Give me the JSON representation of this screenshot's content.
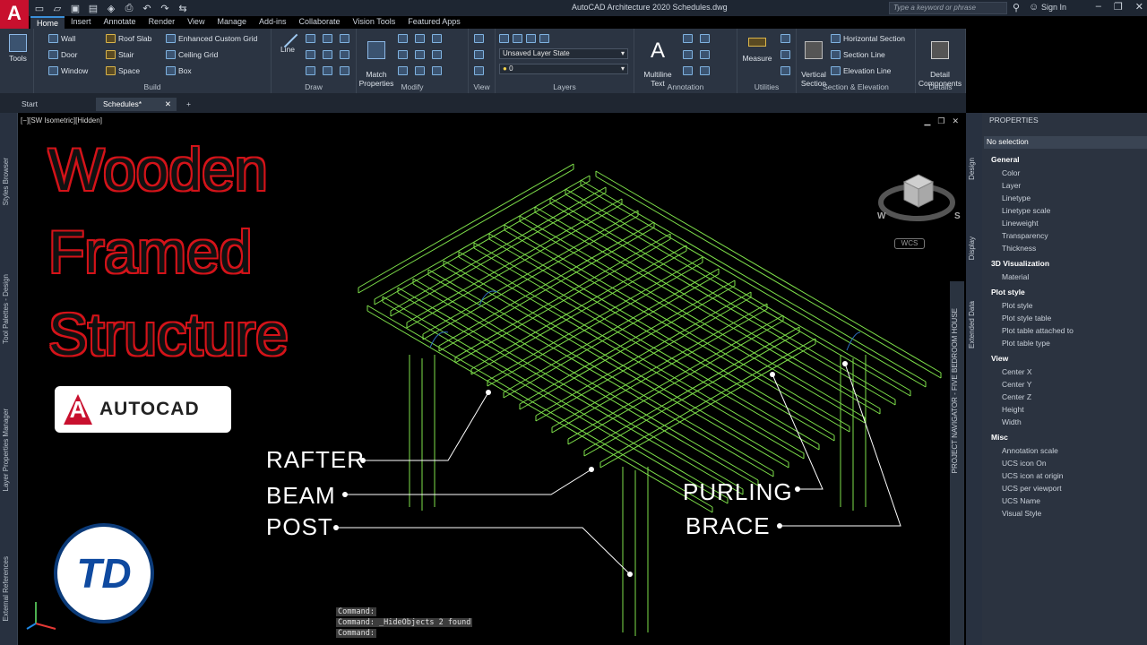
{
  "titlebar": {
    "logo": "A",
    "title": "AutoCAD Architecture 2020    Schedules.dwg",
    "search_placeholder": "Type a keyword or phrase",
    "signin": "Sign In"
  },
  "ribbon_tabs": [
    "Home",
    "Insert",
    "Annotate",
    "Render",
    "View",
    "Manage",
    "Add-ins",
    "Collaborate",
    "Vision Tools",
    "Featured Apps"
  ],
  "ribbon": {
    "tools": "Tools",
    "build": {
      "title": "Build",
      "items": [
        "Wall",
        "Door",
        "Window",
        "Roof Slab",
        "Stair",
        "Space",
        "Enhanced Custom Grid",
        "Ceiling Grid",
        "Box"
      ]
    },
    "draw": {
      "title": "Draw",
      "line": "Line"
    },
    "modify": {
      "title": "Modify",
      "match": "Match\nProperties"
    },
    "view": {
      "title": "View"
    },
    "layers": {
      "title": "Layers",
      "layer_state": "Unsaved Layer State",
      "layer_current": "0"
    },
    "annotation": {
      "title": "Annotation",
      "mtext": "Multiline\nText"
    },
    "utilities": {
      "title": "Utilities",
      "measure": "Measure"
    },
    "section": {
      "title": "Section & Elevation",
      "vertical": "Vertical\nSection",
      "items": [
        "Horizontal Section",
        "Section Line",
        "Elevation Line"
      ]
    },
    "details": {
      "title": "Details",
      "detail": "Detail\nComponents"
    }
  },
  "file_tabs": [
    "Start",
    "Schedules*"
  ],
  "left_palettes": [
    "Styles Browser",
    "Tool Palettes - Design",
    "Layer Properties Manager",
    "External References"
  ],
  "viewport": {
    "label": "[−][SW Isometric][Hidden]",
    "wcs": "WCS",
    "project_navigator": "PROJECT NAVIGATOR - FIVE BEDROOM HOUSE"
  },
  "overlay": {
    "title_lines": [
      "Wooden",
      "Framed",
      "Structure"
    ],
    "autocad": "AUTOCAD",
    "callouts": {
      "rafter": "RAFTER",
      "beam": "BEAM",
      "post": "POST",
      "purling": "PURLING",
      "brace": "BRACE"
    },
    "logo_text": "TD"
  },
  "command_lines": [
    "Command:",
    "Command: _HideObjects 2 found",
    "Command:"
  ],
  "properties": {
    "title": "PROPERTIES",
    "selection": "No selection",
    "side_tabs": [
      "Design",
      "Display",
      "Extended Data"
    ],
    "sections": [
      {
        "name": "General",
        "rows": [
          "Color",
          "Layer",
          "Linetype",
          "Linetype scale",
          "Lineweight",
          "Transparency",
          "Thickness"
        ]
      },
      {
        "name": "3D Visualization",
        "rows": [
          "Material"
        ]
      },
      {
        "name": "Plot style",
        "rows": [
          "Plot style",
          "Plot style table",
          "Plot table attached to",
          "Plot table type"
        ]
      },
      {
        "name": "View",
        "rows": [
          "Center X",
          "Center Y",
          "Center Z",
          "Height",
          "Width"
        ]
      },
      {
        "name": "Misc",
        "rows": [
          "Annotation scale",
          "UCS icon On",
          "UCS icon at origin",
          "UCS per viewport",
          "UCS Name",
          "Visual Style"
        ]
      }
    ]
  },
  "colors": {
    "accent": "#e0131c",
    "structure": "#7ee04a",
    "ui_dark": "#2b3442"
  }
}
